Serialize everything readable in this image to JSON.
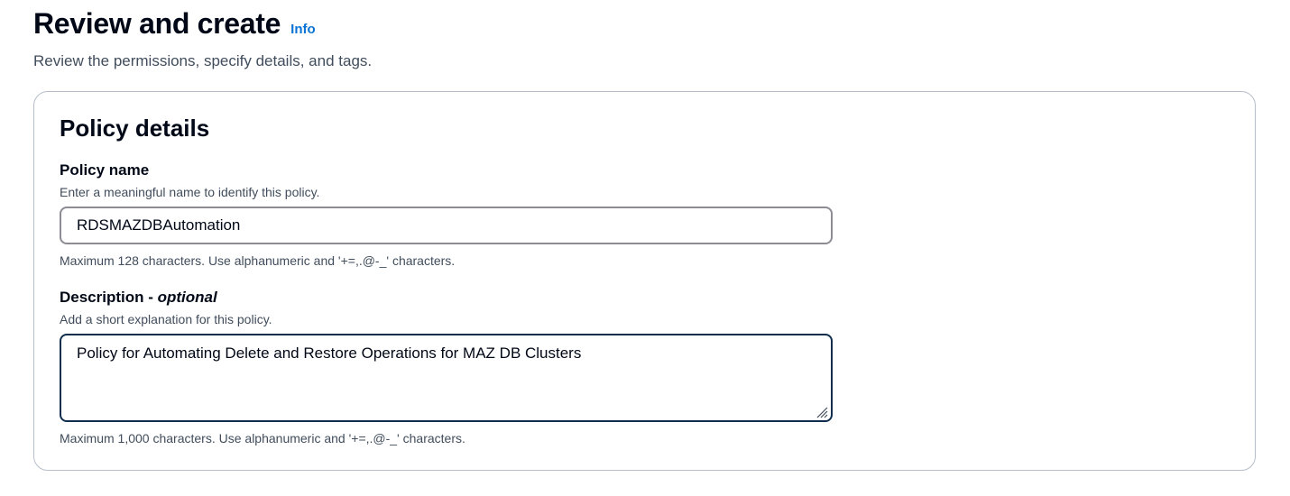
{
  "header": {
    "title": "Review and create",
    "info_link": "Info",
    "subtitle": "Review the permissions, specify details, and tags."
  },
  "policy_details": {
    "title": "Policy details",
    "policy_name": {
      "label": "Policy name",
      "description": "Enter a meaningful name to identify this policy.",
      "value": "RDSMAZDBAutomation",
      "constraint": "Maximum 128 characters. Use alphanumeric and '+=,.@-_' characters."
    },
    "description": {
      "label": "Description - ",
      "label_optional": "optional",
      "description": "Add a short explanation for this policy.",
      "value": "Policy for Automating Delete and Restore Operations for MAZ DB Clusters",
      "constraint": "Maximum 1,000 characters. Use alphanumeric and '+=,.@-_' characters."
    }
  },
  "icons": {
    "resize_handle": "resize-grip-icon"
  },
  "colors": {
    "link": "#0972d3",
    "focused_border": "#0f2d4d",
    "input_border": "#8c8c94",
    "panel_border": "#b6bec9"
  }
}
